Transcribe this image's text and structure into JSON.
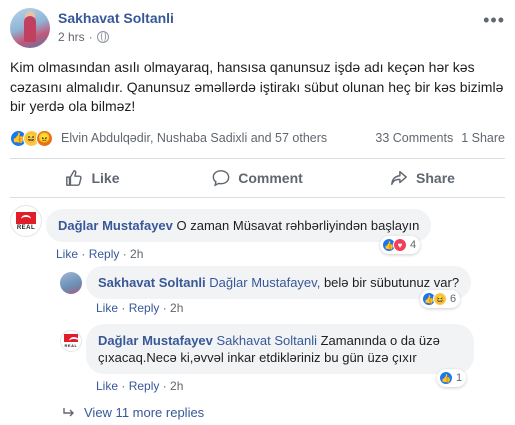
{
  "post": {
    "author": "Sakhavat Soltanli",
    "time": "2 hrs",
    "more": "•••",
    "text": "Kim olmasından asılı olmayaraq, hansısa qanunsuz işdə adı keçən hər kəs cəzasını almalıdır. Qanunsuz əməllərdə iştirakı sübut olunan heç bir kəs bizimlə bir yerdə ola bilməz!",
    "reactors": "Elvin Abdulqədir, Nushaba Sadixli and 57 others",
    "comments_count": "33 Comments",
    "shares_count": "1 Share"
  },
  "actions": {
    "like": "Like",
    "comment": "Comment",
    "share": "Share"
  },
  "comments": [
    {
      "name": "Dağlar Mustafayev",
      "tag": "",
      "text": "O zaman Müsavat rəhbərliyindən başlayın",
      "like": "Like",
      "reply": "Reply",
      "time": "2h",
      "reactions_count": "4",
      "avatar_label": "REAL"
    },
    {
      "name": "Sakhavat Soltanli",
      "tag": "Dağlar Mustafayev,",
      "text": "belə bir sübutunuz var?",
      "like": "Like",
      "reply": "Reply",
      "time": "2h",
      "reactions_count": "6"
    },
    {
      "name": "Dağlar Mustafayev",
      "tag": "Sakhavat Soltanli",
      "text_line1": "Zamanında o da üzə",
      "text_line2": "çıxacaq.Necə ki,əvvəl inkar etdikləriniz bu gün üzə çıxır",
      "like": "Like",
      "reply": "Reply",
      "time": "2h",
      "reactions_count": "1",
      "avatar_label": "REAL"
    }
  ],
  "view_more": "View 11 more replies",
  "colors": {
    "link": "#385898",
    "like_blue": "#1877f2",
    "love_red": "#f33e58",
    "bubble": "#f2f3f5",
    "muted": "#606770"
  }
}
